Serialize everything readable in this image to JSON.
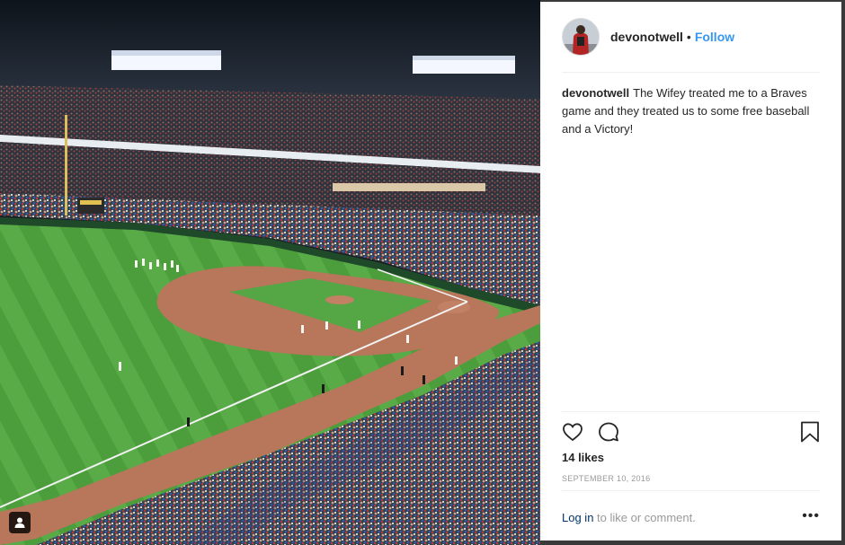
{
  "post": {
    "username": "devonotwell",
    "follow_label": "Follow",
    "separator": "•",
    "caption": "The Wifey treated me to a Braves game and they treated us to some free baseball and a Victory!",
    "likes": "14 likes",
    "date": "SEPTEMBER 10, 2016"
  },
  "comment_bar": {
    "login_label": "Log in",
    "suffix": " to like or comment.",
    "more_label": "•••"
  },
  "colors": {
    "accent": "#3897f0",
    "grass": "#4a9a3a",
    "infield_dirt": "#b8765a"
  },
  "icons": [
    "heart-icon",
    "comment-icon",
    "bookmark-icon",
    "user-tag-icon",
    "more-options-icon"
  ]
}
